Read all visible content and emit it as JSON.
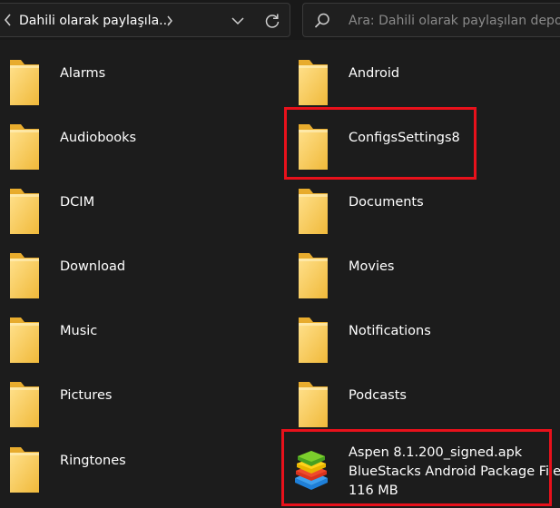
{
  "address_bar": {
    "path": "Dahili olarak paylaşıla..."
  },
  "search": {
    "placeholder": "Ara: Dahili olarak paylaşılan depolama"
  },
  "items": [
    {
      "name": "Alarms",
      "type": "folder",
      "icon": "folder-icon"
    },
    {
      "name": "Android",
      "type": "folder",
      "icon": "folder-icon"
    },
    {
      "name": "Audiobooks",
      "type": "folder",
      "icon": "folder-icon"
    },
    {
      "name": "ConfigsSettings8",
      "type": "folder",
      "icon": "folder-icon",
      "highlighted": true
    },
    {
      "name": "DCIM",
      "type": "folder",
      "icon": "folder-icon"
    },
    {
      "name": "Documents",
      "type": "folder",
      "icon": "folder-icon"
    },
    {
      "name": "Download",
      "type": "folder",
      "icon": "folder-icon"
    },
    {
      "name": "Movies",
      "type": "folder",
      "icon": "folder-icon"
    },
    {
      "name": "Music",
      "type": "folder",
      "icon": "folder-icon"
    },
    {
      "name": "Notifications",
      "type": "folder",
      "icon": "folder-icon"
    },
    {
      "name": "Pictures",
      "type": "folder",
      "icon": "folder-icon"
    },
    {
      "name": "Podcasts",
      "type": "folder",
      "icon": "folder-icon"
    },
    {
      "name": "Ringtones",
      "type": "folder",
      "icon": "folder-icon"
    },
    {
      "name": "Aspen 8.1.200_signed.apk",
      "type": "file",
      "icon": "bluestacks-icon",
      "file_type": "BlueStacks Android Package File",
      "size": "116 MB",
      "highlighted": true
    }
  ],
  "colors": {
    "background": "#1c1c1c",
    "highlight": "#e8111b",
    "folder_yellow": "#f5c542"
  }
}
